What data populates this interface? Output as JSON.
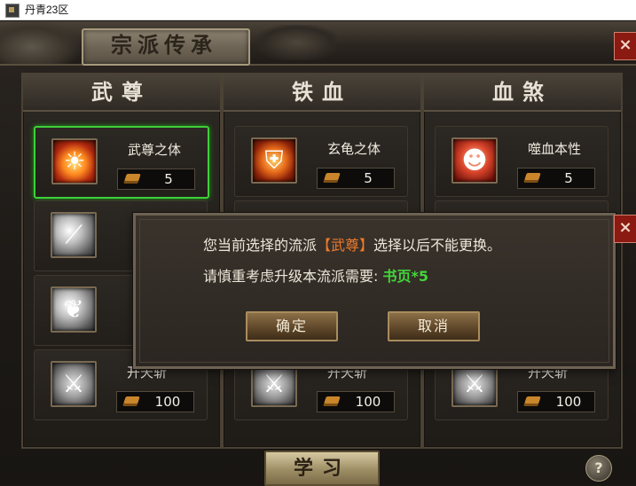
{
  "window": {
    "title": "丹青23区"
  },
  "panel": {
    "title": "宗派传承"
  },
  "columns": [
    {
      "name": "武尊",
      "skills": [
        {
          "name": "武尊之体",
          "cost": "5",
          "icon": "fire-body-icon"
        },
        {
          "name": "",
          "cost": "",
          "icon": "blade-slash-icon"
        },
        {
          "name": "",
          "cost": "",
          "icon": "feather-blade-icon"
        },
        {
          "name": "开天斩",
          "cost": "100",
          "icon": "halberd-icon"
        }
      ]
    },
    {
      "name": "铁血",
      "skills": [
        {
          "name": "玄龟之体",
          "cost": "5",
          "icon": "turtle-shield-icon"
        },
        {
          "name": "开天斩",
          "cost": "100",
          "icon": "halberd-icon"
        }
      ]
    },
    {
      "name": "血煞",
      "skills": [
        {
          "name": "噬血本性",
          "cost": "5",
          "icon": "blood-rage-icon"
        },
        {
          "name": "开天斩",
          "cost": "100",
          "icon": "halberd-icon"
        }
      ]
    }
  ],
  "learn_button": "学习",
  "help_button": "?",
  "dialog": {
    "line1_prefix": "您当前选择的流派",
    "line1_accent": "【武尊】",
    "line1_suffix": "选择以后不能更换。",
    "line2_prefix": "请慎重考虑升级本流派需要:",
    "line2_cost": "书页*5",
    "confirm": "确定",
    "cancel": "取消"
  },
  "close_label": "×",
  "colors": {
    "selected_border": "#3fcf3a",
    "accent_orange": "#ef7a2b",
    "cost_green": "#42d63a"
  }
}
